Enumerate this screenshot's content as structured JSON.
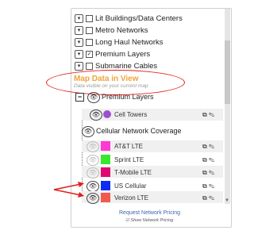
{
  "layers": [
    {
      "label": "Lit Buildings/Data Centers",
      "checked": false
    },
    {
      "label": "Metro Networks",
      "checked": false
    },
    {
      "label": "Long Haul Networks",
      "checked": false
    },
    {
      "label": "Premium Layers",
      "checked": true
    },
    {
      "label": "Submarine Cables",
      "checked": false
    }
  ],
  "map_data": {
    "title": "Map Data in View",
    "subtitle": "Data visible on your current map"
  },
  "premium": {
    "header": "Premium Layers",
    "cell_towers": "Cell Towers",
    "coverage_header": "Cellular Network Coverage",
    "carriers": [
      {
        "label": "AT&T LTE",
        "color": "#ff38d6"
      },
      {
        "label": "Sprint LTE",
        "color": "#37e82d"
      },
      {
        "label": "T-Mobile LTE",
        "color": "#e1086f"
      },
      {
        "label": "US Cellular",
        "color": "#0b2df2"
      },
      {
        "label": "Verizon LTE",
        "color": "#f05a4c"
      }
    ],
    "cell_tower_color": "#9b4fd0"
  },
  "footer": {
    "link": "Request Network Pricing",
    "sub": "Show Network Pricing"
  },
  "icons": {
    "chevron": "chevron-down-icon",
    "eye": "eye-icon",
    "edit": "pencil-icon",
    "expand": "expand-icon"
  }
}
